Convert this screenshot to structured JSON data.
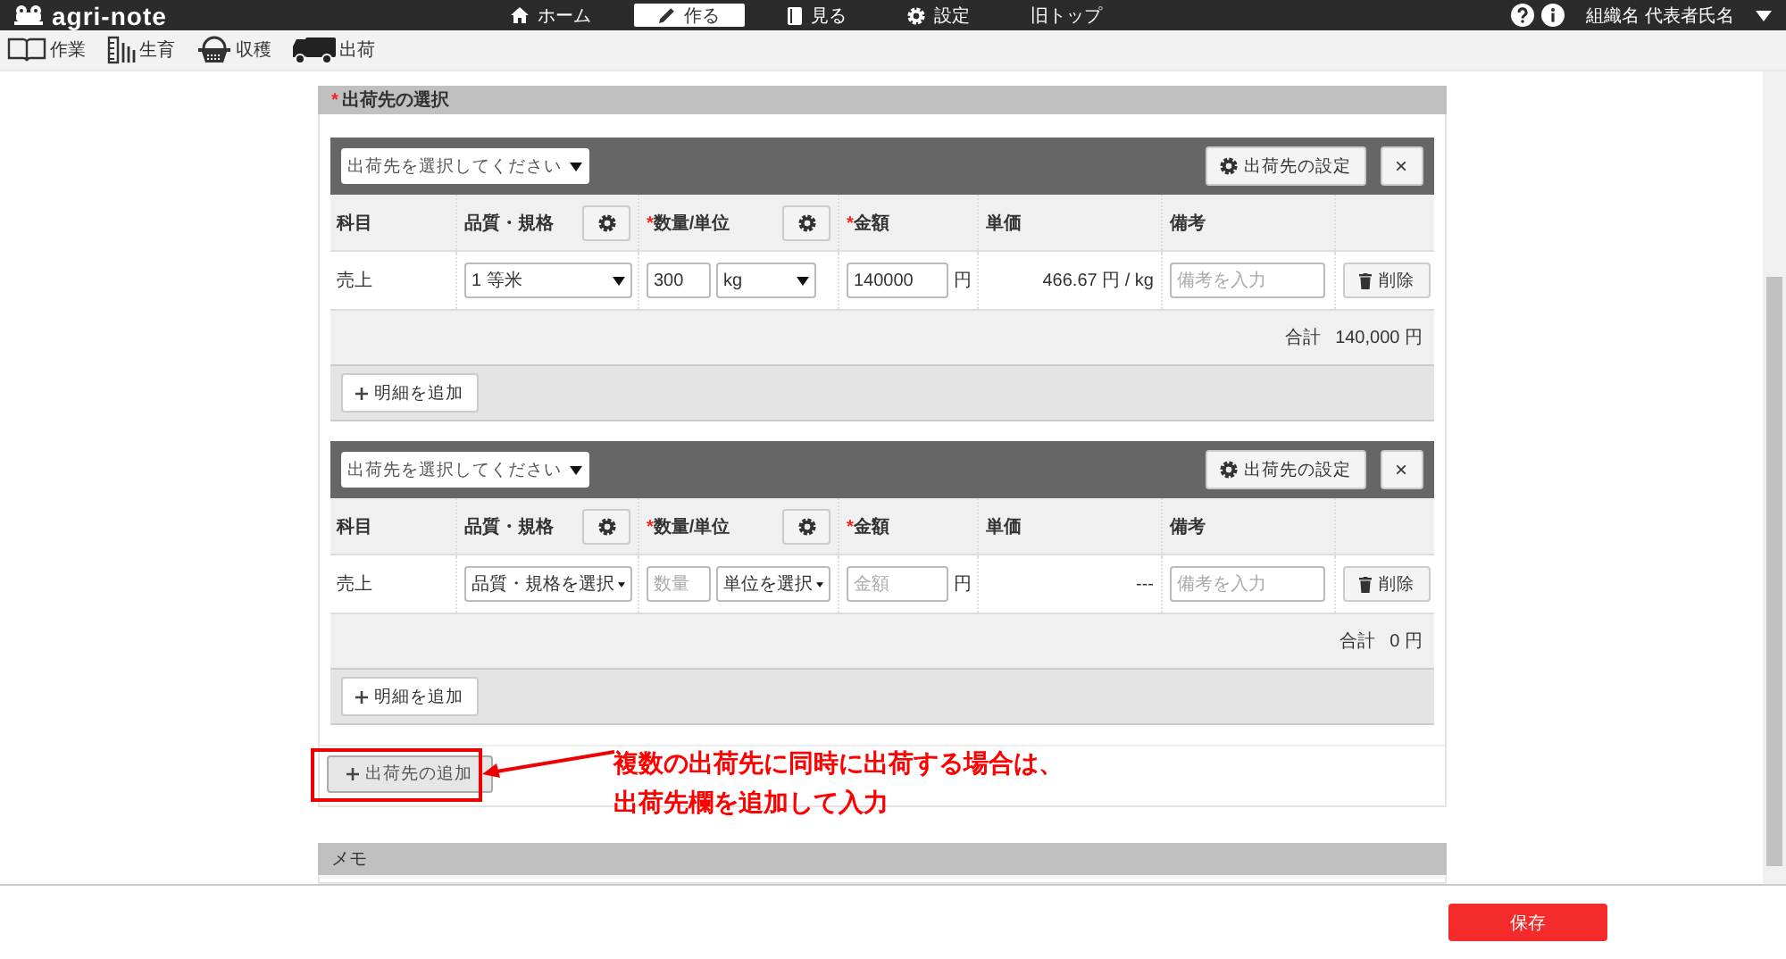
{
  "header": {
    "logo": "agri-note",
    "nav": [
      {
        "label": "ホーム",
        "selected": false
      },
      {
        "label": "作る",
        "selected": true
      },
      {
        "label": "見る",
        "selected": false
      },
      {
        "label": "設定",
        "selected": false
      },
      {
        "label": "旧トップ",
        "selected": false
      }
    ],
    "user": "組織名 代表者氏名"
  },
  "subnav": [
    {
      "label": "作業"
    },
    {
      "label": "生育"
    },
    {
      "label": "収穫"
    },
    {
      "label": "出荷"
    }
  ],
  "section": {
    "mark": "*",
    "title": "出荷先の選択"
  },
  "destinations": [
    {
      "select": "出荷先を選択してください",
      "settings_button": "出荷先の設定",
      "close": "×",
      "columns": [
        {
          "label": "科目",
          "gear": false
        },
        {
          "label": "品質・規格",
          "gear": true
        },
        {
          "mark": "*",
          "label": "数量/単位",
          "gear": true
        },
        {
          "mark": "*",
          "label": "金額",
          "gear": false
        },
        {
          "label": "単価",
          "gear": false
        },
        {
          "label": "備考",
          "gear": false
        }
      ],
      "rows": [
        {
          "subject": "売上",
          "quality": "1 等米",
          "quantity": {
            "value": "300"
          },
          "unit": "kg",
          "amount": {
            "value": "140000"
          },
          "yen": "円",
          "unit_price": "466.67 円 / kg",
          "note": {
            "placeholder": "備考を入力"
          },
          "delete": "削除"
        }
      ],
      "total_label": "合計",
      "total": "140,000 円",
      "add_line": "明細を追加"
    },
    {
      "select": "出荷先を選択してください",
      "settings_button": "出荷先の設定",
      "close": "×",
      "columns": [
        {
          "label": "科目",
          "gear": false
        },
        {
          "label": "品質・規格",
          "gear": true
        },
        {
          "mark": "*",
          "label": "数量/単位",
          "gear": true
        },
        {
          "mark": "*",
          "label": "金額",
          "gear": false
        },
        {
          "label": "単価",
          "gear": false
        },
        {
          "label": "備考",
          "gear": false
        }
      ],
      "rows": [
        {
          "subject": "売上",
          "quality": "品質・規格を選択",
          "quantity": {
            "placeholder": "数量"
          },
          "unit": "単位を選択",
          "amount": {
            "placeholder": "金額"
          },
          "yen": "円",
          "unit_price": "---",
          "note": {
            "placeholder": "備考を入力"
          },
          "delete": "削除"
        }
      ],
      "total_label": "合計",
      "total": "0 円",
      "add_line": "明細を追加"
    }
  ],
  "add_destination": "出荷先の追加",
  "annotation": {
    "lines": [
      "複数の出荷先に同時に出荷する場合は、",
      "出荷先欄を追加して入力"
    ]
  },
  "memo": {
    "title": "メモ"
  },
  "save": "保存"
}
